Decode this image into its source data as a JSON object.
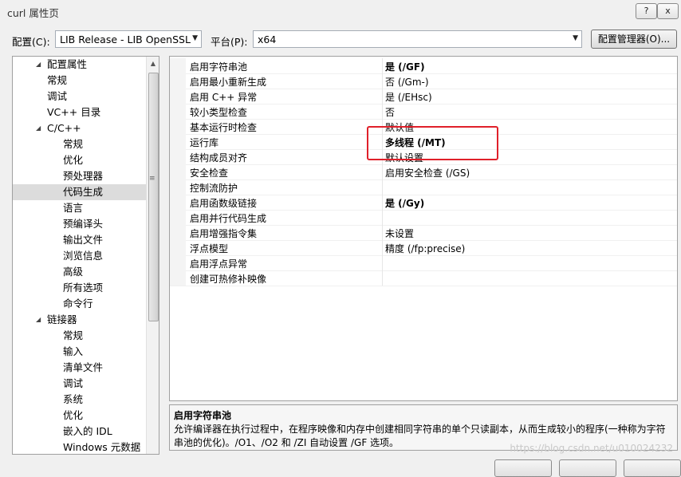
{
  "window": {
    "title": "curl 属性页",
    "help_button": "?",
    "close_button": "x"
  },
  "config_row": {
    "config_label": "配置(C):",
    "config_value": "LIB Release - LIB OpenSSL",
    "platform_label": "平台(P):",
    "platform_value": "x64",
    "manager_button": "配置管理器(O)..."
  },
  "tree": {
    "items": [
      {
        "label": "配置属性",
        "expander": "◢"
      },
      {
        "label": "常规"
      },
      {
        "label": "调试"
      },
      {
        "label": "VC++ 目录"
      },
      {
        "label": "C/C++",
        "expander": "◢"
      },
      {
        "label": "常规"
      },
      {
        "label": "优化"
      },
      {
        "label": "预处理器"
      },
      {
        "label": "代码生成",
        "selected": true
      },
      {
        "label": "语言"
      },
      {
        "label": "预编译头"
      },
      {
        "label": "输出文件"
      },
      {
        "label": "浏览信息"
      },
      {
        "label": "高级"
      },
      {
        "label": "所有选项"
      },
      {
        "label": "命令行"
      },
      {
        "label": "链接器",
        "expander": "◢"
      },
      {
        "label": "常规"
      },
      {
        "label": "输入"
      },
      {
        "label": "清单文件"
      },
      {
        "label": "调试"
      },
      {
        "label": "系统"
      },
      {
        "label": "优化"
      },
      {
        "label": "嵌入的 IDL"
      },
      {
        "label": "Windows 元数据"
      }
    ],
    "scroll_up": "▲",
    "scroll_grip": "≡"
  },
  "properties": [
    {
      "name": "启用字符串池",
      "value": "是 (/GF)",
      "bold": true
    },
    {
      "name": "启用最小重新生成",
      "value": "否 (/Gm-)"
    },
    {
      "name": "启用 C++ 异常",
      "value": "是 (/EHsc)"
    },
    {
      "name": "较小类型检查",
      "value": "否"
    },
    {
      "name": "基本运行时检查",
      "value": "默认值"
    },
    {
      "name": "运行库",
      "value": "多线程 (/MT)",
      "bold": true
    },
    {
      "name": "结构成员对齐",
      "value": "默认设置"
    },
    {
      "name": "安全检查",
      "value": "启用安全检查 (/GS)"
    },
    {
      "name": "控制流防护",
      "value": ""
    },
    {
      "name": "启用函数级链接",
      "value": "是 (/Gy)",
      "bold": true
    },
    {
      "name": "启用并行代码生成",
      "value": ""
    },
    {
      "name": "启用增强指令集",
      "value": "未设置"
    },
    {
      "name": "浮点模型",
      "value": "精度 (/fp:precise)"
    },
    {
      "name": "启用浮点异常",
      "value": ""
    },
    {
      "name": "创建可热修补映像",
      "value": ""
    }
  ],
  "description": {
    "title": "启用字符串池",
    "text": "允许编译器在执行过程中，在程序映像和内存中创建相同字符串的单个只读副本，从而生成较小的程序(一种称为字符串池的优化)。/O1、/O2 和 /ZI 自动设置 /GF 选项。"
  },
  "watermark": "https://blog.csdn.net/u010024232",
  "colors": {
    "highlight_box": "#e0202a",
    "selected_row": "#dcdcdc"
  }
}
